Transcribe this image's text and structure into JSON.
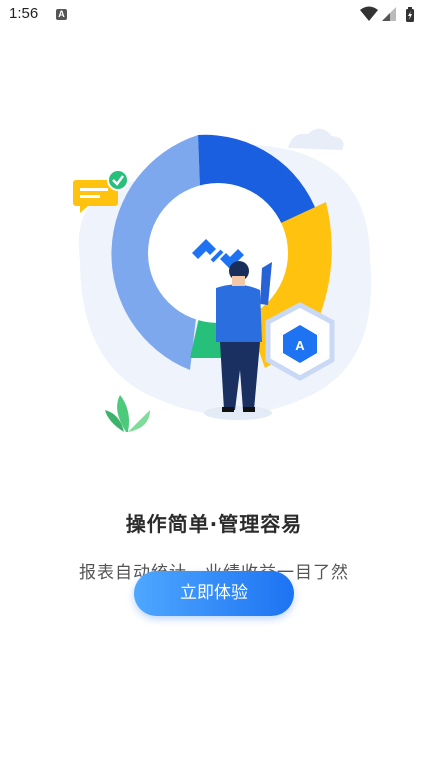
{
  "status_bar": {
    "time": "1:56",
    "notif_letter": "A"
  },
  "onboarding": {
    "headline": "操作简单·管理容易",
    "subline": "报表自动统计，业绩收益一目了然",
    "cta_label": "立即体验",
    "badge_letter": "A"
  },
  "colors": {
    "primary_blue": "#1d73f2",
    "donut_light_blue": "#7ea8ee",
    "donut_dark_blue": "#1a5fe0",
    "donut_yellow": "#ffc20e",
    "donut_green": "#27c07a"
  },
  "icons": [
    "wifi-icon",
    "signal-icon",
    "battery-icon",
    "chat-bubble-icon",
    "check-icon",
    "logo-icon",
    "hexagon-badge-icon",
    "plant-icon"
  ]
}
